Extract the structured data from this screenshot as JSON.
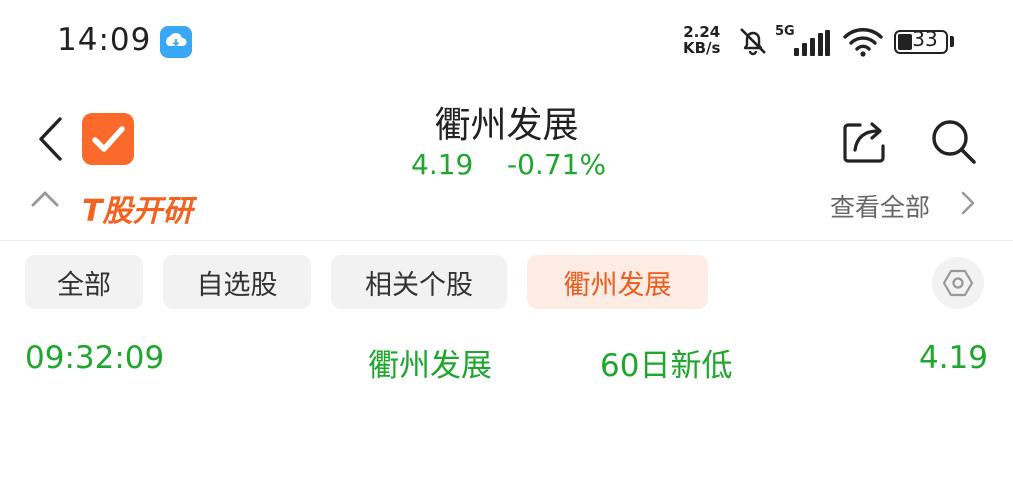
{
  "status_bar": {
    "time": "14:09",
    "net_speed_value": "2.24",
    "net_speed_unit": "KB/s",
    "network_type": "5G",
    "battery": "33"
  },
  "header": {
    "title": "衢州发展",
    "price": "4.19",
    "change": "-0.71%"
  },
  "banner": {
    "text": "T股开研",
    "link": "查看全部"
  },
  "tabs": [
    {
      "label": "全部",
      "active": false
    },
    {
      "label": "自选股",
      "active": false
    },
    {
      "label": "相关个股",
      "active": false
    },
    {
      "label": "衢州发展",
      "active": true
    }
  ],
  "rows": [
    {
      "time": "09:32:09",
      "name": "衢州发展",
      "event": "60日新低",
      "price": "4.19"
    }
  ],
  "colors": {
    "up_down_green": "#1ea62d",
    "accent_orange": "#ef5a1d",
    "app_badge_blue": "#39a7f3"
  }
}
